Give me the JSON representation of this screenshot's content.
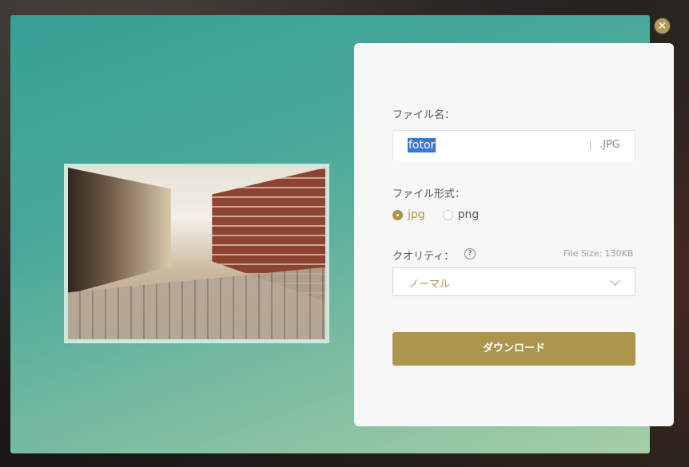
{
  "dialog": {
    "close_label": "×",
    "filename_label": "ファイル名：",
    "filename_value": "fotor",
    "extension": ".JPG",
    "format_label": "ファイル形式：",
    "format_options": [
      {
        "label": "jpg",
        "selected": true
      },
      {
        "label": "png",
        "selected": false
      }
    ],
    "quality_label": "クオリティ：",
    "help_glyph": "?",
    "file_size": "File Size: 130KB",
    "quality_value": "ノーマル",
    "download_label": "ダウンロード"
  },
  "colors": {
    "accent": "#ad954e",
    "modal_gradient_start": "#37a094",
    "modal_gradient_end": "#a6cea6",
    "panel_bg": "#f7f7f7",
    "selection": "#3a78d8"
  },
  "icons": {
    "close": "close-icon",
    "help": "help-icon",
    "dropdown": "chevron-down-icon"
  }
}
